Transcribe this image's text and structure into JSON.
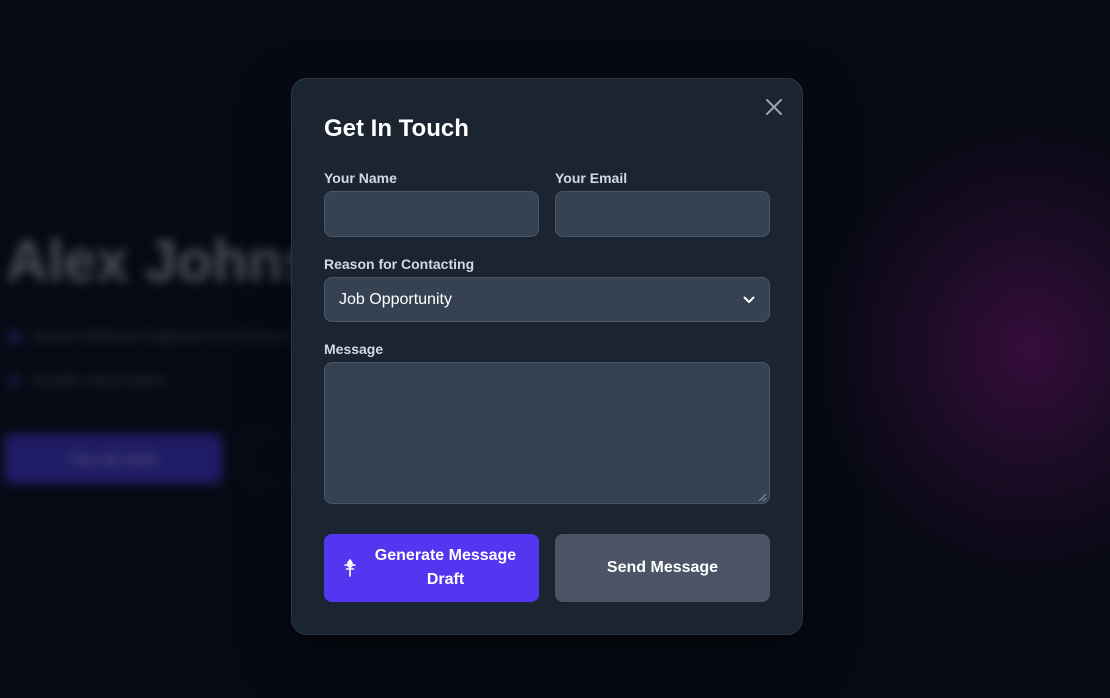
{
  "background": {
    "name": "Alex Johnson",
    "line1": "Senior Software Engineer & AI Researcher",
    "line2": "Seattle, Washington",
    "primary_button": "View My Work"
  },
  "modal": {
    "title": "Get In Touch",
    "name_label": "Your Name",
    "name_value": "",
    "email_label": "Your Email",
    "email_value": "",
    "reason_label": "Reason for Contacting",
    "reason_selected": "Job Opportunity",
    "message_label": "Message",
    "message_value": "",
    "generate_button": "Generate Message Draft",
    "send_button": "Send Message",
    "icons": {
      "close": "close-icon",
      "generate": "sparkle-icon",
      "dropdown": "chevron-down-icon"
    }
  },
  "colors": {
    "accent": "#5536f0",
    "modal_bg": "#1b2431",
    "input_bg": "#364152",
    "secondary_button": "#4b5566",
    "glow": "#8c1482"
  }
}
